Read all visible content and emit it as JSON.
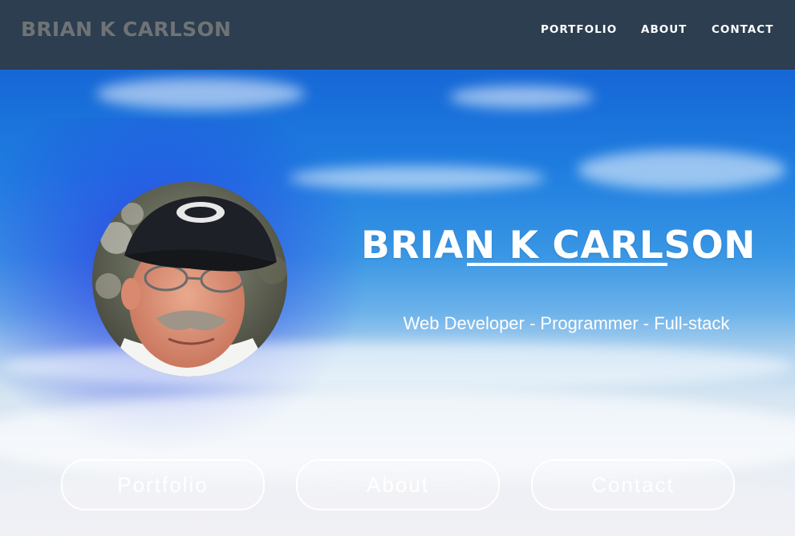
{
  "navbar": {
    "brand": "BRIAN K CARLSON",
    "links": [
      {
        "label": "PORTFOLIO"
      },
      {
        "label": "ABOUT"
      },
      {
        "label": "CONTACT"
      }
    ]
  },
  "hero": {
    "title": "BRIAN K CARLSON",
    "tagline": "Web Developer - Programmer - Full-stack",
    "buttons": [
      {
        "label": "Portfolio"
      },
      {
        "label": "About"
      },
      {
        "label": "Contact"
      }
    ]
  },
  "colors": {
    "navbar_bg": "#2c3e50",
    "brand_text": "#6f7376",
    "nav_text": "#ffffff",
    "sky_top": "#1667d6",
    "accent_white": "#ffffff"
  }
}
